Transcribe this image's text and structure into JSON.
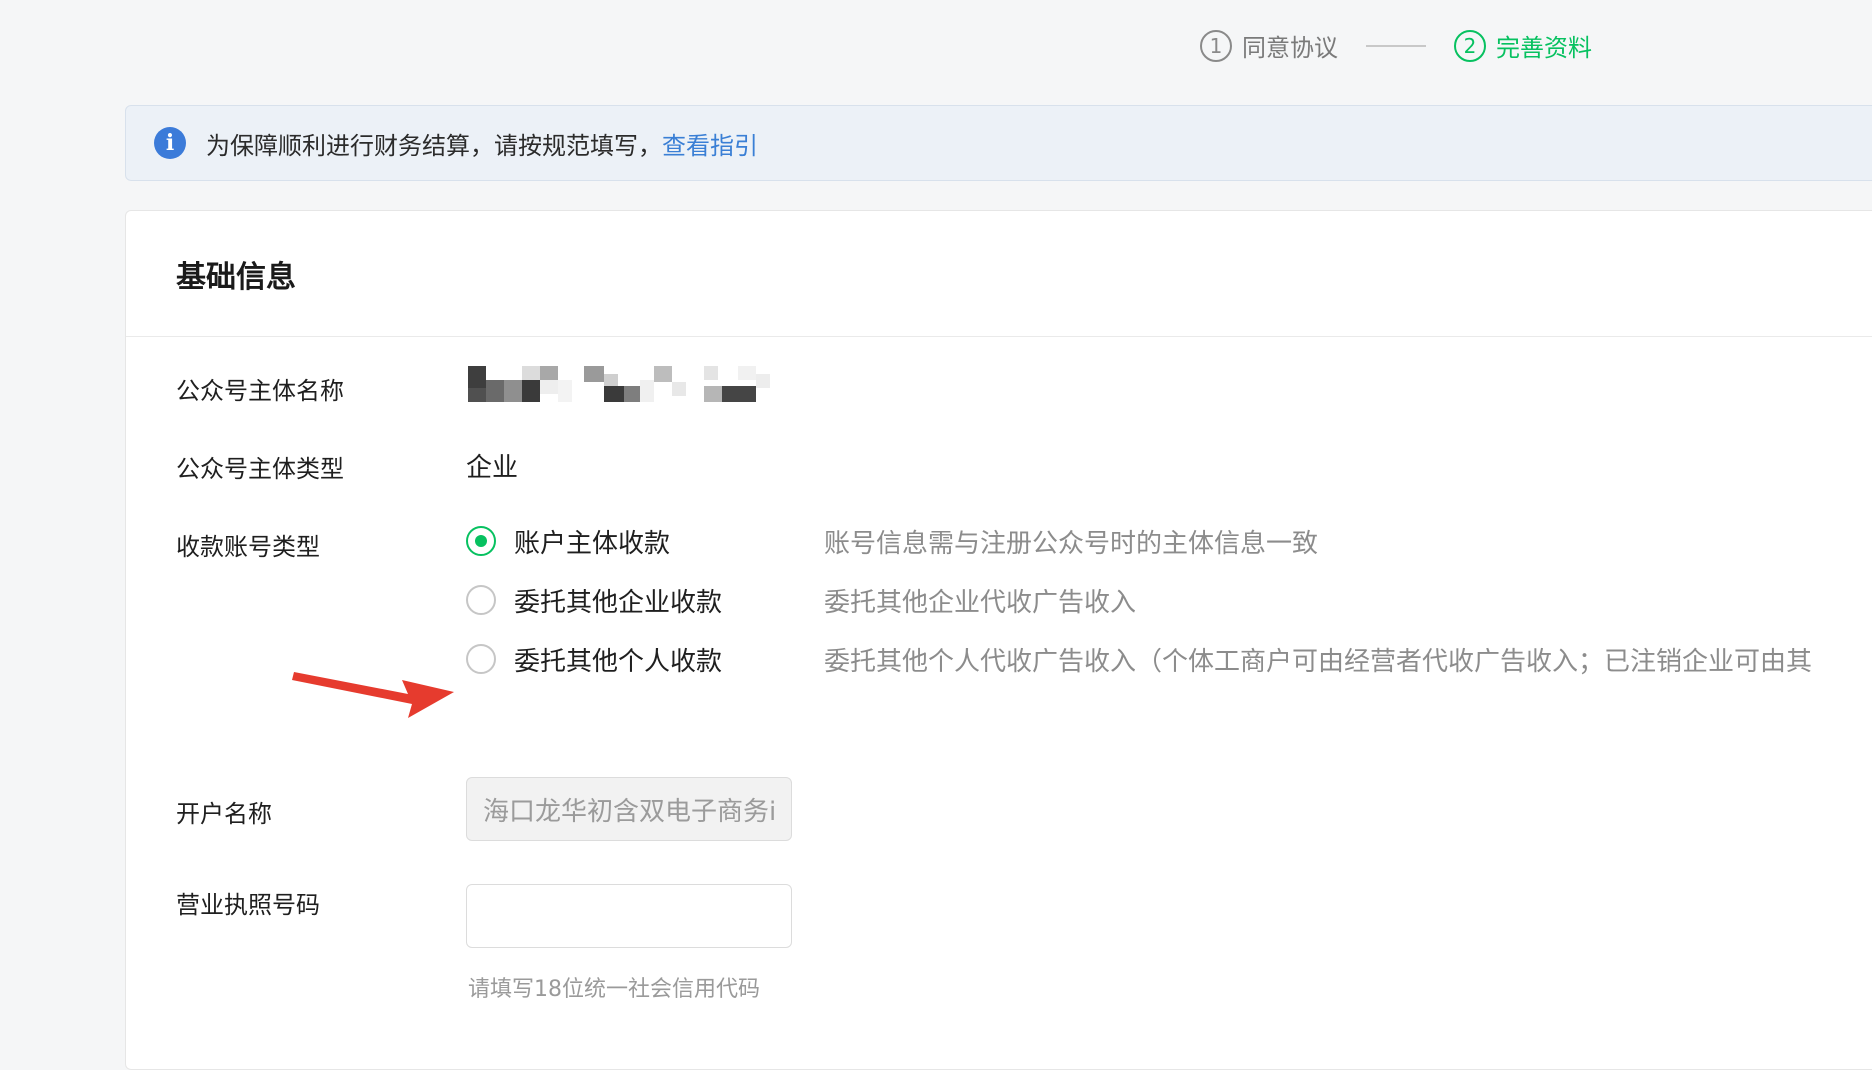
{
  "steps": [
    {
      "num": "1",
      "label": "同意协议"
    },
    {
      "num": "2",
      "label": "完善资料"
    }
  ],
  "notice": {
    "text": "为保障顺利进行财务结算，请按规范填写，",
    "link": "查看指引"
  },
  "card": {
    "title": "基础信息",
    "fields": {
      "name_label": "公众号主体名称",
      "type_label": "公众号主体类型",
      "type_value": "企业",
      "account_type_label": "收款账号类型",
      "account_name_label": "开户名称",
      "account_name_value": "海口龙华初含双电子商务i",
      "license_label": "营业执照号码",
      "license_value": "",
      "license_hint": "请填写18位统一社会信用代码"
    },
    "radio_options": [
      {
        "label": "账户主体收款",
        "desc": "账号信息需与注册公众号时的主体信息一致",
        "checked": true
      },
      {
        "label": "委托其他企业收款",
        "desc": "委托其他企业代收广告收入",
        "checked": false
      },
      {
        "label": "委托其他个人收款",
        "desc": "委托其他个人代收广告收入（个体工商户可由经营者代收广告收入；已注销企业可由其",
        "checked": false
      }
    ]
  },
  "colors": {
    "accent_green": "#07c160",
    "link_blue": "#3a7fd5",
    "arrow_red": "#e63b2e"
  }
}
